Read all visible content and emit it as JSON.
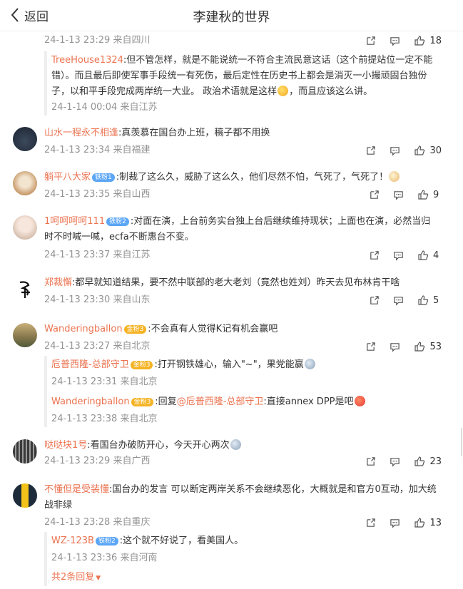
{
  "header": {
    "back_label": "返回",
    "title": "李建秋的世界"
  },
  "comments": [
    {
      "meta": "24-1-13 23:29 来自四川",
      "likes": "18",
      "replies": [
        {
          "user": "TreeHouse1324",
          "lines": [
            ":但不管怎样，就是不能说统一不符合主流民意这话（这个前提站位一定不能",
            "错）。而且最后即使军事手段统一有死伤，最后定性在历史书上都会是消灭一小撮顽固台独份",
            "子，以和平手段完成两岸统一大业。 政治术语就是这样"
          ],
          "line3_tail": "，而且应该这么讲。",
          "meta": "24-1-14 00:04 来自江苏"
        }
      ]
    },
    {
      "user": "山水一程永不相逢",
      "text": ":真羡慕在国台办上班，稿子都不用换",
      "meta": "24-1-13 23:34 来自福建",
      "likes": "30"
    },
    {
      "user": "躺平八大家",
      "badge": "铁粉1",
      "text": ":制裁了这么久，威胁了这么久，他们尽然不怕，气死了，气死了！",
      "meta": "24-1-13 23:35 来自山西",
      "likes": "9"
    },
    {
      "user": "1呵呵呵呵111",
      "badge": "铁粉2",
      "text": ":对面在演，上台前务实台独上台后继续维持现状；上面也在演，必然当归",
      "text2": "时不时喊一喊，ecfa不断惠台不变。",
      "meta": "24-1-13 23:37 来自江苏",
      "likes": "4"
    },
    {
      "user": "郑裁懈",
      "text": ":都早就知道结果，要不然中联部的老大老刘（竟然也姓刘）昨天去见布林肯干啥",
      "meta": "24-1-13 23:30 来自山东",
      "likes": "5"
    },
    {
      "user": "Wanderingballon",
      "badge": "金粉3",
      "text": ":不会真有人觉得K记有机会赢吧",
      "meta": "24-1-13 23:27 来自北京",
      "likes": "53",
      "replies": [
        {
          "user": "卮普西隆-总部守卫",
          "badge": "金粉3",
          "text": ":打开钢铁雄心，输入\"~\"，果党能赢",
          "meta": "24-1-13 23:31 来自北京"
        },
        {
          "user": "Wanderingballon",
          "badge": "金粉3",
          "pre": ":回复",
          "mention": "@卮普西隆-总部守卫",
          "text": ":直接annex DPP是吧",
          "meta": "24-1-13 23:38 来自北京"
        }
      ]
    },
    {
      "user": "哒哒块1号",
      "text": ":看国台办破防开心，今天开心两次",
      "meta": "24-1-13 23:29 来自广西",
      "likes": "23"
    },
    {
      "user": "不懂但是受装懂",
      "text": ":国台办的发言 可以断定两岸关系不会继续恶化，大概就是和官方0互动，加大统",
      "text2": "战非绿",
      "meta": "24-1-13 23:28 来自重庆",
      "likes": "13",
      "replies": [
        {
          "user": "WZ-123B",
          "badge": "铁粉2",
          "text": ":这个就不好说了，看美国人。",
          "meta": "24-1-13 23:36 来自河南"
        }
      ],
      "more_replies": "共2条回复"
    }
  ],
  "colors": {
    "username": "#eb7350",
    "meta": "#939393",
    "badge_blue": "#5ba6f6",
    "badge_gold": "#f5b324"
  }
}
